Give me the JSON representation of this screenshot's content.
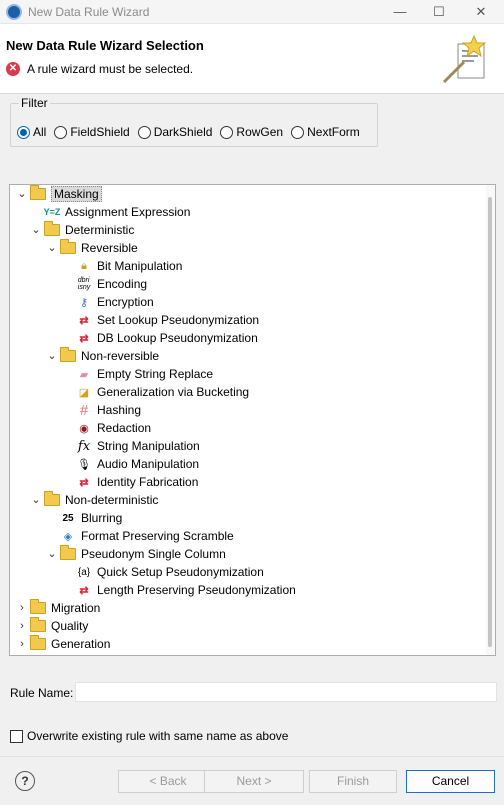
{
  "window": {
    "title": "New Data Rule Wizard"
  },
  "banner": {
    "title": "New Data Rule Wizard Selection",
    "error": "A rule wizard must be selected."
  },
  "filter": {
    "legend": "Filter",
    "options": [
      "All",
      "FieldShield",
      "DarkShield",
      "RowGen",
      "NextForm"
    ],
    "selected": "All"
  },
  "tree": {
    "items": [
      {
        "label": "Masking",
        "icon": "folder-open-icon",
        "expanded": true,
        "selected": true
      },
      {
        "label": "Assignment Expression",
        "icon": "assignment-expression-icon",
        "icon_text": "Y=Z"
      },
      {
        "label": "Deterministic",
        "icon": "folder-open-icon",
        "expanded": true
      },
      {
        "label": "Reversible",
        "icon": "folder-open-icon",
        "expanded": true
      },
      {
        "label": "Bit Manipulation",
        "icon": "lock-icon"
      },
      {
        "label": "Encoding",
        "icon": "encoding-icon"
      },
      {
        "label": "Encryption",
        "icon": "key-icon"
      },
      {
        "label": "Set Lookup Pseudonymization",
        "icon": "pseudonym-icon"
      },
      {
        "label": "DB Lookup Pseudonymization",
        "icon": "pseudonym-icon"
      },
      {
        "label": "Non-reversible",
        "icon": "folder-open-icon",
        "expanded": true
      },
      {
        "label": "Empty String Replace",
        "icon": "eraser-icon"
      },
      {
        "label": "Generalization via Bucketing",
        "icon": "bucket-icon"
      },
      {
        "label": "Hashing",
        "icon": "hash-icon",
        "icon_text": "#"
      },
      {
        "label": "Redaction",
        "icon": "mask-icon"
      },
      {
        "label": "String Manipulation",
        "icon": "function-icon",
        "icon_text": "fx"
      },
      {
        "label": "Audio Manipulation",
        "icon": "microphone-icon"
      },
      {
        "label": "Identity Fabrication",
        "icon": "pseudonym-icon"
      },
      {
        "label": "Non-deterministic",
        "icon": "folder-open-icon",
        "expanded": true
      },
      {
        "label": "Blurring",
        "icon": "blur-icon",
        "icon_text": "25"
      },
      {
        "label": "Format Preserving Scramble",
        "icon": "cube-icon"
      },
      {
        "label": "Pseudonym Single Column",
        "icon": "folder-open-icon",
        "expanded": true
      },
      {
        "label": "Quick Setup Pseudonymization",
        "icon": "braces-icon",
        "icon_text": "{a}"
      },
      {
        "label": "Length Preserving Pseudonymization",
        "icon": "pseudonym-icon"
      },
      {
        "label": "Migration",
        "icon": "folder-icon",
        "expanded": false
      },
      {
        "label": "Quality",
        "icon": "folder-icon",
        "expanded": false
      },
      {
        "label": "Generation",
        "icon": "folder-icon",
        "expanded": false
      }
    ]
  },
  "rule_name": {
    "label": "Rule Name:",
    "value": ""
  },
  "overwrite": {
    "label": "Overwrite existing rule with same name as above",
    "checked": false
  },
  "buttons": {
    "back": "< Back",
    "next": "Next >",
    "finish": "Finish",
    "cancel": "Cancel"
  },
  "colors": {
    "accent": "#0063b1",
    "error": "#d9394a",
    "folder": "#f2c94c"
  }
}
